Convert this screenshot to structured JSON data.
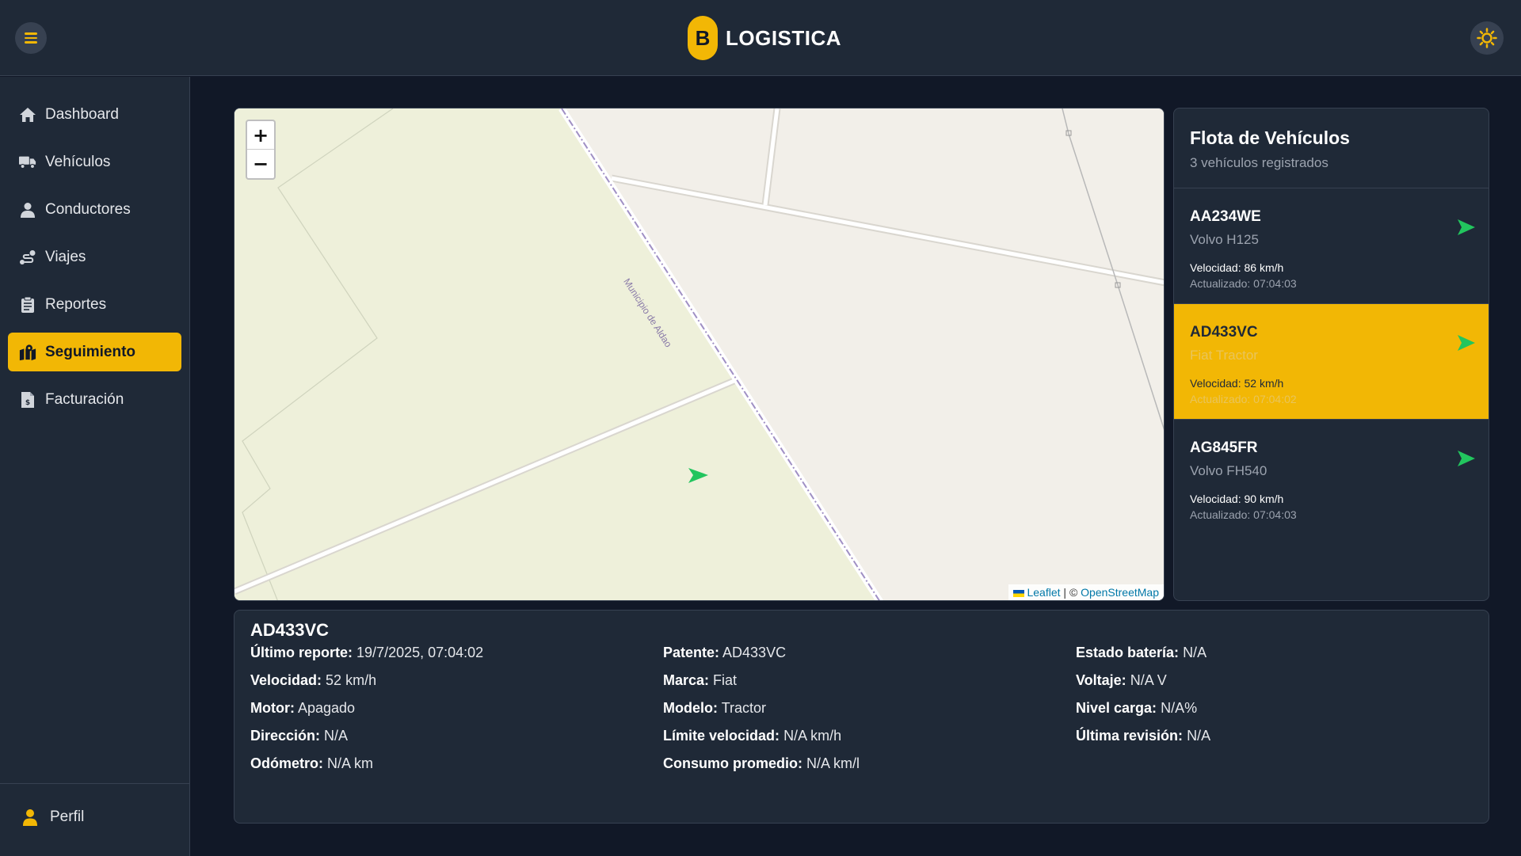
{
  "header": {
    "brand_letter": "B",
    "brand_name": "LOGISTICA",
    "menu_icon": "hamburger-icon",
    "theme_icon": "sun-icon",
    "accent_color": "#f2b705"
  },
  "sidebar": {
    "items": [
      {
        "label": "Dashboard",
        "icon": "home-icon"
      },
      {
        "label": "Vehículos",
        "icon": "truck-icon"
      },
      {
        "label": "Conductores",
        "icon": "user-icon"
      },
      {
        "label": "Viajes",
        "icon": "route-icon"
      },
      {
        "label": "Reportes",
        "icon": "clipboard-icon"
      },
      {
        "label": "Seguimiento",
        "icon": "map-location-icon",
        "active": true
      },
      {
        "label": "Facturación",
        "icon": "invoice-icon"
      }
    ],
    "profile_label": "Perfil"
  },
  "map": {
    "zoom_in": "+",
    "zoom_out": "−",
    "road_label": "Municipio de Aldao",
    "attribution_leaflet": "Leaflet",
    "attribution_sep": "| ©",
    "attribution_osm": "OpenStreetMap"
  },
  "fleet": {
    "title": "Flota de Vehículos",
    "subtitle": "3 vehículos registrados",
    "vehicles": [
      {
        "plate": "AA234WE",
        "model": "Volvo H125",
        "speed": "Velocidad: 86 km/h",
        "updated": "Actualizado: 07:04:03"
      },
      {
        "plate": "AD433VC",
        "model": "Fiat Tractor",
        "speed": "Velocidad: 52 km/h",
        "updated": "Actualizado: 07:04:02",
        "selected": true
      },
      {
        "plate": "AG845FR",
        "model": "Volvo FH540",
        "speed": "Velocidad: 90 km/h",
        "updated": "Actualizado: 07:04:03"
      }
    ]
  },
  "details": {
    "title": "AD433VC",
    "col1": [
      {
        "label": "Último reporte:",
        "value": "19/7/2025, 07:04:02"
      },
      {
        "label": "Velocidad:",
        "value": "52 km/h"
      },
      {
        "label": "Motor:",
        "value": "Apagado"
      },
      {
        "label": "Dirección:",
        "value": "N/A"
      },
      {
        "label": "Odómetro:",
        "value": "N/A km"
      }
    ],
    "col2": [
      {
        "label": "Patente:",
        "value": "AD433VC"
      },
      {
        "label": "Marca:",
        "value": "Fiat"
      },
      {
        "label": "Modelo:",
        "value": "Tractor"
      },
      {
        "label": "Límite velocidad:",
        "value": "N/A km/h"
      },
      {
        "label": "Consumo promedio:",
        "value": "N/A km/l"
      }
    ],
    "col3": [
      {
        "label": "Estado batería:",
        "value": "N/A"
      },
      {
        "label": "Voltaje:",
        "value": "N/A V"
      },
      {
        "label": "Nivel carga:",
        "value": "N/A%"
      },
      {
        "label": "Última revisión:",
        "value": "N/A"
      }
    ]
  }
}
